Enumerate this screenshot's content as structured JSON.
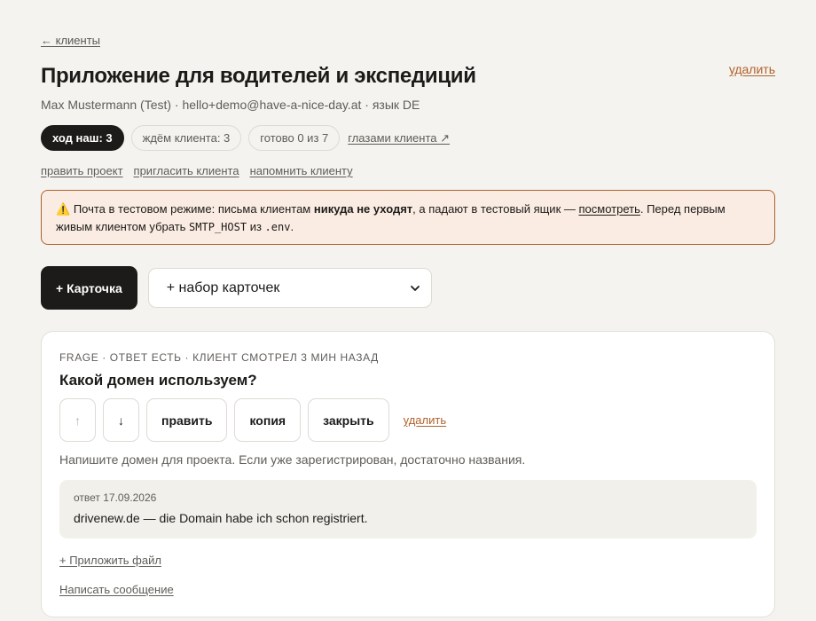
{
  "header": {
    "back_link": "← клиенты",
    "delete_label": "удалить",
    "title": "Приложение для водителей и экспедиций",
    "meta": "Max Mustermann (Test) · hello+demo@have-a-nice-day.at · язык DE"
  },
  "status": {
    "our_move": "ход наш: 3",
    "waiting_client": "ждём клиента: 3",
    "ready": "готово 0 из 7",
    "client_view": "глазами клиента ↗"
  },
  "actions": {
    "edit_project": "править проект",
    "invite_client": "пригласить клиента",
    "remind_client": "напомнить клиенту"
  },
  "notice": {
    "icon": "⚠️",
    "text_1": "Почта в тестовом режиме: письма клиентам ",
    "bold": "никуда не уходят",
    "text_2": ", а падают в тестовый ящик — ",
    "link": "посмотреть",
    "text_3": ". Перед первым живым клиентом убрать ",
    "code_1": "SMTP_HOST",
    "text_4": " из ",
    "code_2": ".env",
    "text_5": "."
  },
  "add": {
    "card_button": "+ Карточка",
    "set_select": "+ набор карточек"
  },
  "card": {
    "meta": "FRAGE · ОТВЕТ ЕСТЬ · КЛИЕНТ СМОТРЕЛ 3 МИН НАЗАД",
    "question": "Какой домен используем?",
    "up": "↑",
    "down": "↓",
    "edit": "править",
    "copy": "копия",
    "close": "закрыть",
    "delete": "удалить",
    "description": "Напишите домен для проекта. Если уже зарегистрирован, достаточно названия.",
    "answer_date": "ответ 17.09.2026",
    "answer_text": "drivenew.de — die Domain habe ich schon registriert.",
    "attach": "+ Приложить файл",
    "write": "Написать сообщение"
  }
}
